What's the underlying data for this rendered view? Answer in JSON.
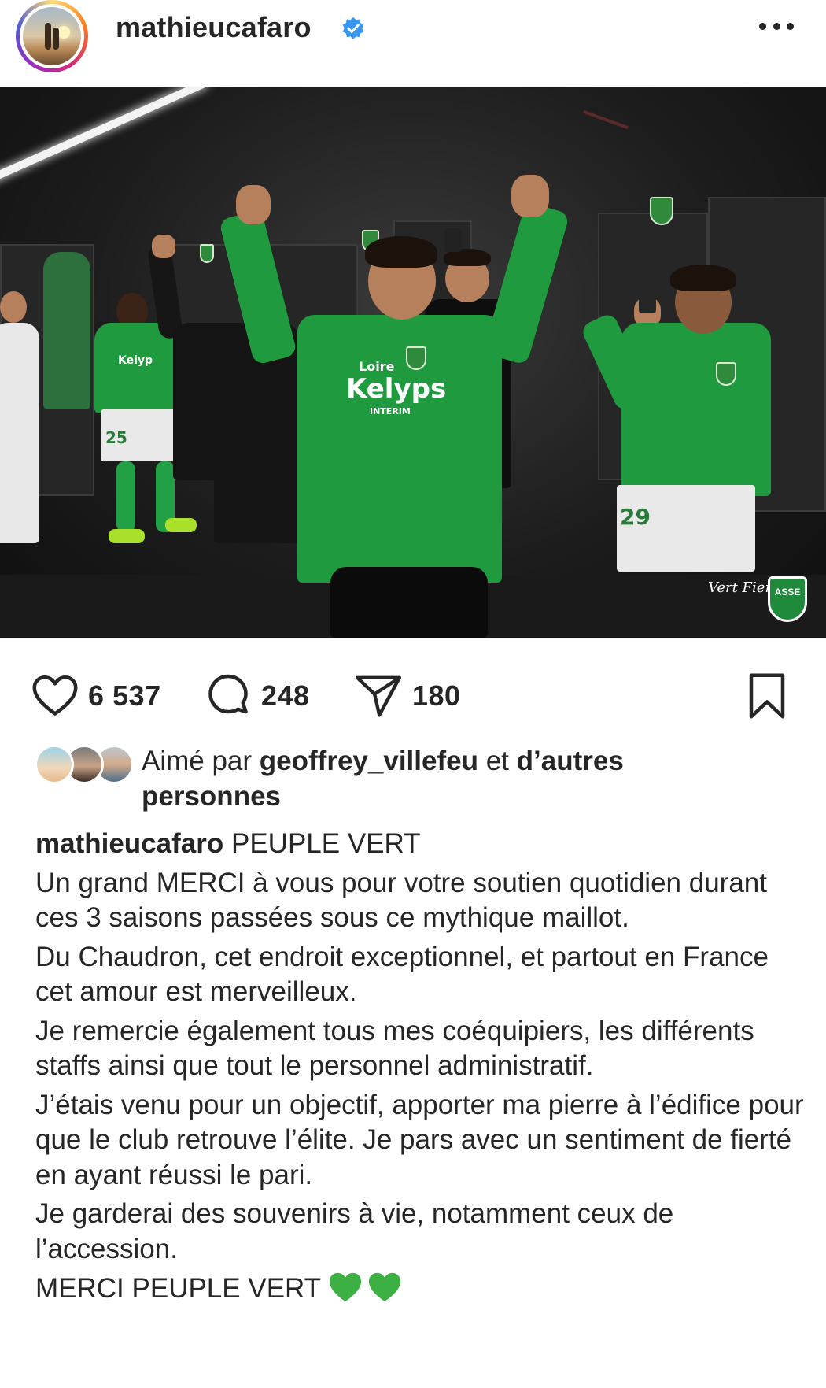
{
  "post": {
    "username": "mathieucafaro",
    "verified": true,
    "more_icon": "more-horizontal-icon"
  },
  "photo": {
    "sponsor_main": "Kelyps",
    "sponsor_top": "Loire",
    "sponsor_sub": "INTERIM",
    "shirt_number_left": "25",
    "shirt_number_right": "29",
    "watermark_logo": "ASSE",
    "watermark_text": "Vert Fier"
  },
  "actions": {
    "like_icon": "heart-outline-icon",
    "likes_count": "6 537",
    "comment_icon": "comment-bubble-icon",
    "comments_count": "248",
    "share_icon": "paper-plane-icon",
    "shares_count": "180",
    "save_icon": "bookmark-icon"
  },
  "liked_by": {
    "prefix": "Aimé par",
    "user": "geoffrey_villefeu",
    "connector": "et",
    "others": "d’autres personnes"
  },
  "caption": {
    "username": "mathieucafaro",
    "title": "PEUPLE VERT",
    "paragraphs": [
      "Un grand MERCI à vous pour votre soutien quotidien durant ces 3 saisons passées sous ce mythique maillot.",
      "Du Chaudron, cet endroit exceptionnel, et partout en France cet amour est merveilleux.",
      "Je remercie également tous mes coéquipiers, les différents staffs ainsi que tout le personnel administratif.",
      "J’étais venu pour un objectif, apporter ma pierre à l’édifice pour que le club retrouve l’élite. Je pars avec un sentiment de fierté en ayant réussi le pari.",
      "Je garderai des souvenirs à vie, notamment ceux de l’accession."
    ],
    "closing": "MERCI PEUPLE VERT",
    "emoji_icon": "green-heart-icon"
  },
  "colors": {
    "text": "#262626",
    "verified_blue": "#3897f0",
    "jersey_green": "#1f9a3e",
    "heart_green": "#3cb043"
  }
}
